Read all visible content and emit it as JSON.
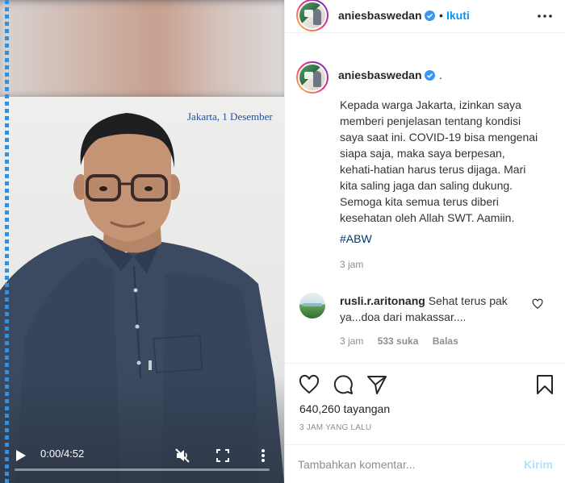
{
  "video": {
    "overlay_text": "Jakarta, 1 Desember",
    "time_current": "0:00",
    "time_separator": " / ",
    "time_total": "4:52",
    "progress_fraction": 0.0
  },
  "header": {
    "username": "aniesbaswedan",
    "separator": "•",
    "follow_label": "Ikuti"
  },
  "caption": {
    "username": "aniesbaswedan",
    "trailing": ".",
    "lines": [
      "Kepada warga Jakarta, izinkan saya",
      "memberi penjelasan tentang kondisi",
      "saya saat ini. COVID-19 bisa mengenai",
      "siapa saja, maka saya berpesan,",
      "kehati-hatian harus terus dijaga. Mari",
      "kita saling jaga dan saling dukung.",
      "Semoga kita semua terus diberi",
      "kesehatan oleh Allah SWT. Aamiin."
    ],
    "hashtag": "#ABW",
    "time": "3 jam"
  },
  "comment": {
    "username": "rusli.r.aritonang",
    "text": "Sehat terus pak ya...doa dari makassar....",
    "time": "3 jam",
    "likes": "533 suka",
    "reply_label": "Balas"
  },
  "actions": {
    "views": "640,260 tayangan",
    "posted": "3 JAM YANG LALU"
  },
  "add_comment": {
    "placeholder": "Tambahkan komentar...",
    "post_label": "Kirim"
  },
  "colors": {
    "accent": "#0095f6",
    "verified": "#3897f0",
    "hashtag": "#00376b",
    "post_disabled": "#b2dffc",
    "video_edge": "#3b8ed6"
  },
  "icons": [
    "play-icon",
    "mute-icon",
    "fullscreen-icon",
    "more-vertical-icon",
    "verified-icon",
    "more-horizontal-icon",
    "heart-icon",
    "comment-icon",
    "share-icon",
    "bookmark-icon"
  ]
}
